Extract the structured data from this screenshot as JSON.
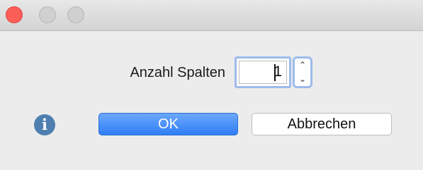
{
  "dialog": {
    "columns_label": "Anzahl Spalten",
    "columns_value": "1",
    "ok_label": "OK",
    "cancel_label": "Abbrechen",
    "stepper_up_glyph": "⌃",
    "stepper_down_glyph": "⌄",
    "info_glyph": "i"
  },
  "icons": {
    "info": "info-icon",
    "stepper": "stepper-arrows-icon"
  },
  "colors": {
    "accent": "#2f7ef6",
    "focus_ring": "#9dbbeb",
    "close": "#fc5f57",
    "info": "#4f7fb0"
  }
}
